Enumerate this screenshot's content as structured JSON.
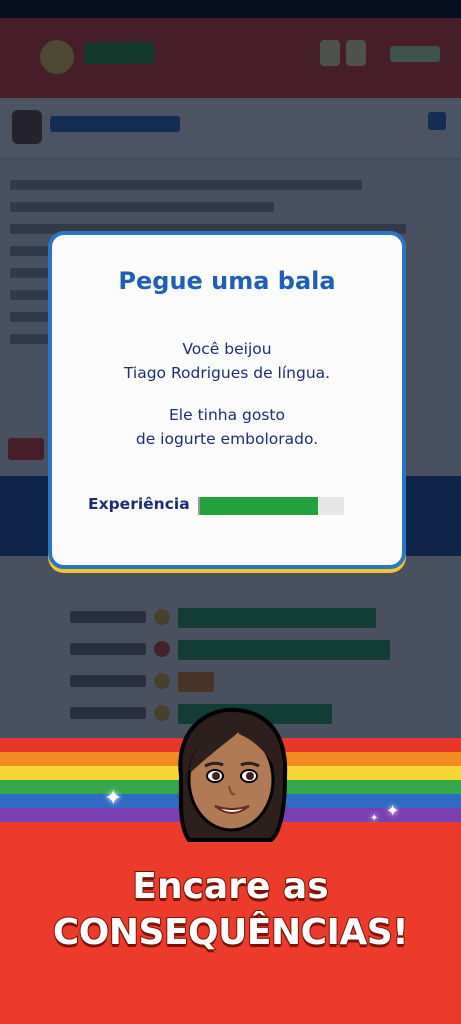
{
  "dialog": {
    "title": "Pegue uma bala",
    "message1_line1": "Você beijou",
    "message1_line2": "Tiago Rodrigues de língua.",
    "message2_line1": "Ele tinha gosto",
    "message2_line2": "de iogurte embolorado.",
    "experience_label": "Experiência",
    "experience_fraction": 0.82,
    "experience_color": "#23a33b"
  },
  "promo": {
    "line1": "Encare as",
    "line2": "CONSEQUÊNCIAS!",
    "avatar_icon": "female-avatar-icon",
    "sparkle_icon": "sparkle-icon"
  },
  "colors": {
    "accent_blue": "#2a76c4",
    "title_blue": "#1f5fb4",
    "text_navy": "#1b2f6e",
    "banner_red": "#ec3b2a",
    "rainbow": [
      "#e8362a",
      "#f28c22",
      "#f6d535",
      "#34a84a",
      "#2f6bc4",
      "#7b3fb0"
    ]
  }
}
